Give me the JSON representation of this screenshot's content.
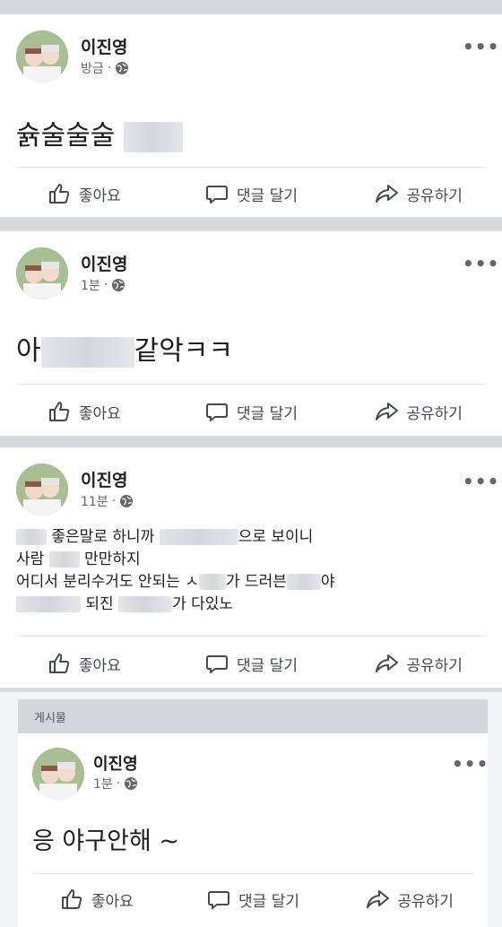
{
  "posts": [
    {
      "author": "이진영",
      "time": "방금",
      "sep": "·",
      "text_parts": [
        "슑술술술"
      ],
      "actions": {
        "like": "좋아요",
        "comment": "댓글 달기",
        "share": "공유하기"
      }
    },
    {
      "author": "이진영",
      "time": "1분",
      "sep": "·",
      "text_parts": [
        "아",
        "같악ㅋㅋ"
      ],
      "actions": {
        "like": "좋아요",
        "comment": "댓글 달기",
        "share": "공유하기"
      }
    },
    {
      "author": "이진영",
      "time": "11분",
      "sep": "·",
      "lines": [
        [
          "좋은말로 하니까",
          "으로 보이니"
        ],
        [
          "사람",
          "만만하지"
        ],
        [
          "어디서 분리수거도 안되는 ㅅ",
          "가 드러븐",
          "야"
        ],
        [
          "되진",
          "가 다있노"
        ]
      ],
      "actions": {
        "like": "좋아요",
        "comment": "댓글 달기",
        "share": "공유하기"
      }
    }
  ],
  "shared": {
    "header": "게시물",
    "author": "이진영",
    "time": "1분",
    "sep": "·",
    "text": "응 야구안해 ~",
    "actions": {
      "like": "좋아요",
      "comment": "댓글 달기",
      "share": "공유하기"
    }
  },
  "colors": {
    "background": "#d7d9dd",
    "card": "#ffffff",
    "meta": "#65676b",
    "action": "#444950"
  }
}
